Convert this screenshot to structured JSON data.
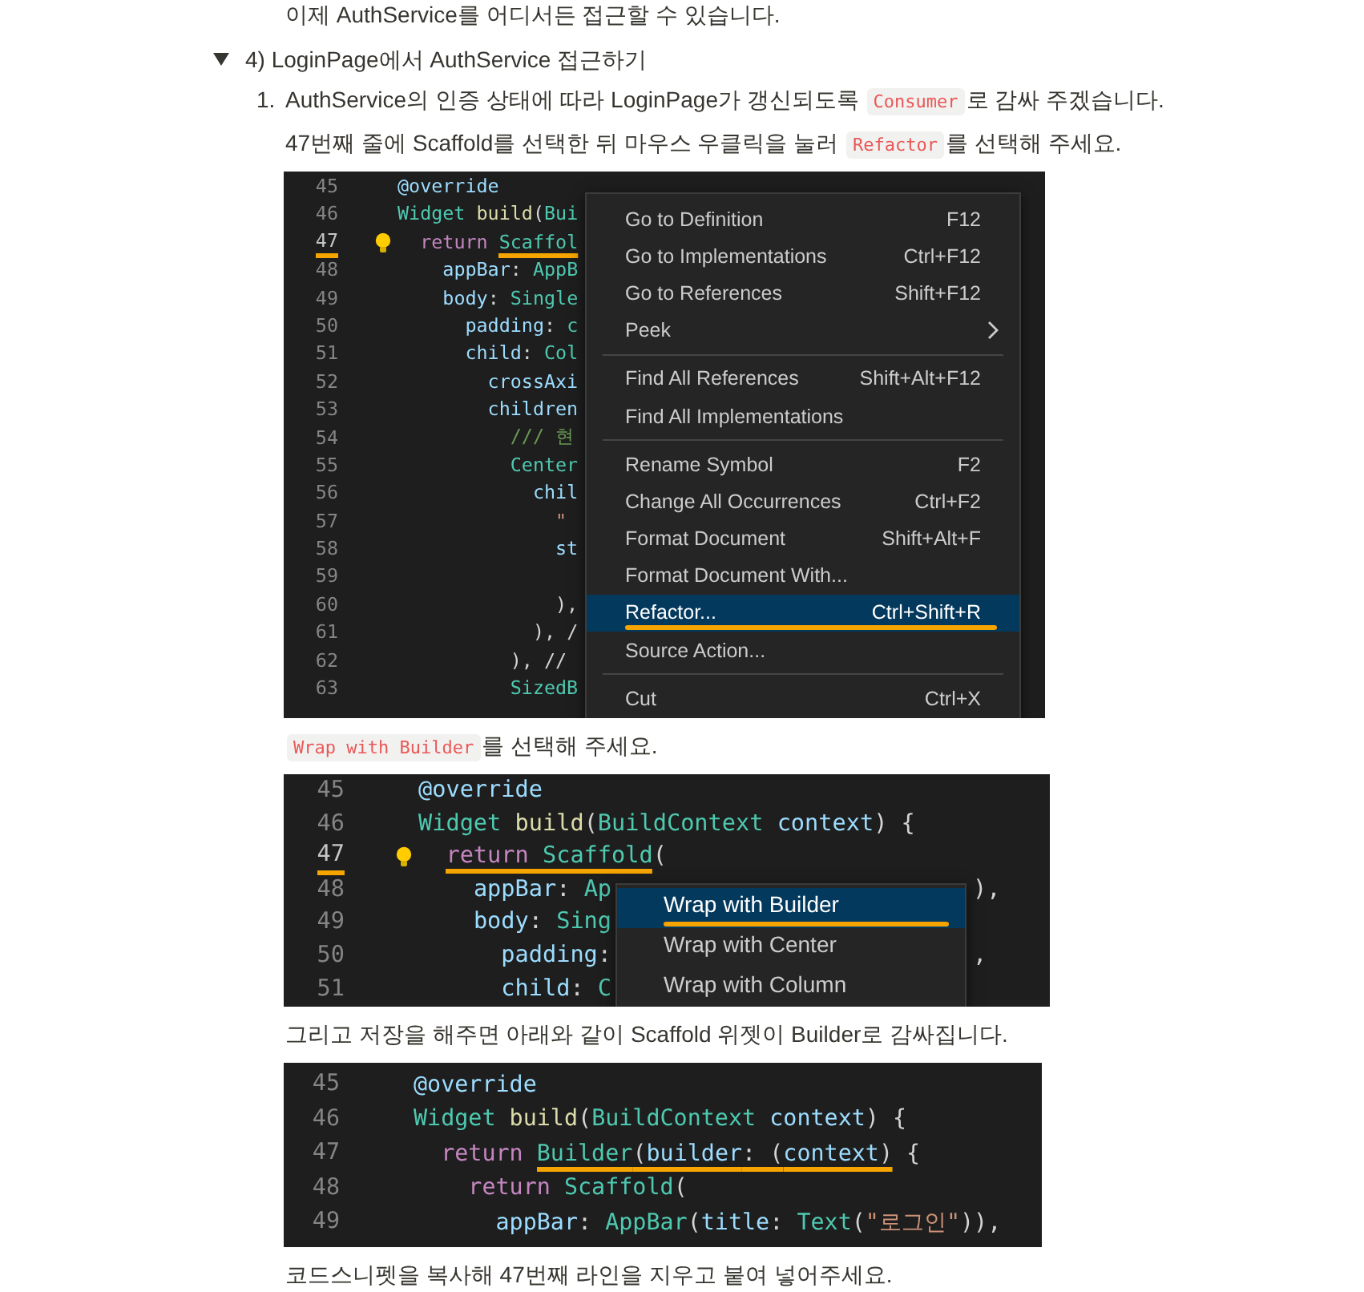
{
  "content": [
    {
      "kind": "paragraph",
      "parts": [
        {
          "kind": "text",
          "text": "이제 AuthService를 어디서든 접근할 수 있습니다."
        }
      ]
    },
    {
      "kind": "toggle",
      "title": "4) LoginPage에서 AuthService 접근하기",
      "expanded": true,
      "children": [
        {
          "kind": "list_item",
          "number": "1.",
          "children": [
            {
              "kind": "paragraph",
              "parts": [
                {
                  "kind": "text",
                  "text": "AuthService의 인증 상태에 따라 LoginPage가 갱신되도록 "
                },
                {
                  "kind": "code",
                  "text": "Consumer"
                },
                {
                  "kind": "text",
                  "text": "로 감싸 주겠습니다."
                }
              ]
            },
            {
              "kind": "paragraph",
              "parts": [
                {
                  "kind": "text",
                  "text": "47번째 줄에 Scaffold를 선택한 뒤 마우스 우클릭을 눌러 "
                },
                {
                  "kind": "code",
                  "text": "Refactor"
                },
                {
                  "kind": "text",
                  "text": "를 선택해 주세요."
                }
              ]
            },
            {
              "kind": "screenshot",
              "lines": [
                {
                  "number": "45",
                  "current": false,
                  "marked": false,
                  "bulb": false,
                  "tokens": [
                    {
                      "text": "@override",
                      "kind": "var",
                      "marked": false
                    }
                  ]
                },
                {
                  "number": "46",
                  "current": false,
                  "marked": false,
                  "bulb": false,
                  "tokens": [
                    {
                      "text": "Widget ",
                      "kind": "type",
                      "marked": false
                    },
                    {
                      "text": "build",
                      "kind": "func",
                      "marked": false
                    },
                    {
                      "text": "(",
                      "kind": "plain",
                      "marked": false
                    },
                    {
                      "text": "Bui",
                      "kind": "type",
                      "marked": false
                    }
                  ]
                },
                {
                  "number": "47",
                  "current": true,
                  "marked": true,
                  "bulb": true,
                  "tokens": [
                    {
                      "text": "  return ",
                      "kind": "keyword",
                      "marked": false
                    },
                    {
                      "text": "Scaffol",
                      "kind": "type",
                      "marked": true
                    }
                  ]
                },
                {
                  "number": "48",
                  "current": false,
                  "marked": false,
                  "bulb": false,
                  "tokens": [
                    {
                      "text": "    appBar",
                      "kind": "var",
                      "marked": false
                    },
                    {
                      "text": ": ",
                      "kind": "plain",
                      "marked": false
                    },
                    {
                      "text": "AppB",
                      "kind": "type",
                      "marked": false
                    }
                  ]
                },
                {
                  "number": "49",
                  "current": false,
                  "marked": false,
                  "bulb": false,
                  "tokens": [
                    {
                      "text": "    body",
                      "kind": "var",
                      "marked": false
                    },
                    {
                      "text": ": ",
                      "kind": "plain",
                      "marked": false
                    },
                    {
                      "text": "Single",
                      "kind": "type",
                      "marked": false
                    }
                  ]
                },
                {
                  "number": "50",
                  "current": false,
                  "marked": false,
                  "bulb": false,
                  "tokens": [
                    {
                      "text": "      padding",
                      "kind": "var",
                      "marked": false
                    },
                    {
                      "text": ": ",
                      "kind": "plain",
                      "marked": false
                    },
                    {
                      "text": "c",
                      "kind": "type",
                      "marked": false
                    }
                  ]
                },
                {
                  "number": "51",
                  "current": false,
                  "marked": false,
                  "bulb": false,
                  "tokens": [
                    {
                      "text": "      child",
                      "kind": "var",
                      "marked": false
                    },
                    {
                      "text": ": ",
                      "kind": "plain",
                      "marked": false
                    },
                    {
                      "text": "Col",
                      "kind": "type",
                      "marked": false
                    }
                  ]
                },
                {
                  "number": "52",
                  "current": false,
                  "marked": false,
                  "bulb": false,
                  "tokens": [
                    {
                      "text": "        crossAxi",
                      "kind": "var",
                      "marked": false
                    }
                  ]
                },
                {
                  "number": "53",
                  "current": false,
                  "marked": false,
                  "bulb": false,
                  "tokens": [
                    {
                      "text": "        children",
                      "kind": "var",
                      "marked": false
                    }
                  ]
                },
                {
                  "number": "54",
                  "current": false,
                  "marked": false,
                  "bulb": false,
                  "tokens": [
                    {
                      "text": "          /// 현",
                      "kind": "comment",
                      "marked": false
                    }
                  ]
                },
                {
                  "number": "55",
                  "current": false,
                  "marked": false,
                  "bulb": false,
                  "tokens": [
                    {
                      "text": "          Center",
                      "kind": "type",
                      "marked": false
                    }
                  ]
                },
                {
                  "number": "56",
                  "current": false,
                  "marked": false,
                  "bulb": false,
                  "tokens": [
                    {
                      "text": "            chil",
                      "kind": "var",
                      "marked": false
                    }
                  ]
                },
                {
                  "number": "57",
                  "current": false,
                  "marked": false,
                  "bulb": false,
                  "tokens": [
                    {
                      "text": "              \"",
                      "kind": "string",
                      "marked": false
                    }
                  ]
                },
                {
                  "number": "58",
                  "current": false,
                  "marked": false,
                  "bulb": false,
                  "tokens": [
                    {
                      "text": "              st",
                      "kind": "var",
                      "marked": false
                    }
                  ]
                },
                {
                  "number": "59",
                  "current": false,
                  "marked": false,
                  "bulb": false
                },
                {
                  "number": "60",
                  "current": false,
                  "marked": false,
                  "bulb": false,
                  "tokens": [
                    {
                      "text": "              ),",
                      "kind": "plain",
                      "marked": false
                    }
                  ]
                },
                {
                  "number": "61",
                  "current": false,
                  "marked": false,
                  "bulb": false,
                  "tokens": [
                    {
                      "text": "            ), /",
                      "kind": "plain",
                      "marked": false
                    }
                  ]
                },
                {
                  "number": "62",
                  "current": false,
                  "marked": false,
                  "bulb": false,
                  "tokens": [
                    {
                      "text": "          ), //",
                      "kind": "plain",
                      "marked": false
                    }
                  ]
                },
                {
                  "number": "63",
                  "current": false,
                  "marked": false,
                  "bulb": false,
                  "tokens": [
                    {
                      "text": "          SizedB",
                      "kind": "type",
                      "marked": false
                    }
                  ]
                }
              ],
              "menu": {
                "groups": [
                  [
                    {
                      "label": "Go to Definition",
                      "shortcut": "F12",
                      "selected": false,
                      "underlined": false,
                      "submenu": false
                    },
                    {
                      "label": "Go to Implementations",
                      "shortcut": "Ctrl+F12",
                      "selected": false,
                      "underlined": false,
                      "submenu": false
                    },
                    {
                      "label": "Go to References",
                      "shortcut": "Shift+F12",
                      "selected": false,
                      "underlined": false,
                      "submenu": false
                    },
                    {
                      "label": "Peek",
                      "selected": false,
                      "underlined": false,
                      "submenu": true
                    }
                  ],
                  [
                    {
                      "label": "Find All References",
                      "shortcut": "Shift+Alt+F12",
                      "selected": false,
                      "underlined": false,
                      "submenu": false
                    },
                    {
                      "label": "Find All Implementations",
                      "selected": false,
                      "underlined": false,
                      "submenu": false
                    }
                  ],
                  [
                    {
                      "label": "Rename Symbol",
                      "shortcut": "F2",
                      "selected": false,
                      "underlined": false,
                      "submenu": false
                    },
                    {
                      "label": "Change All Occurrences",
                      "shortcut": "Ctrl+F2",
                      "selected": false,
                      "underlined": false,
                      "submenu": false
                    },
                    {
                      "label": "Format Document",
                      "shortcut": "Shift+Alt+F",
                      "selected": false,
                      "underlined": false,
                      "submenu": false
                    },
                    {
                      "label": "Format Document With...",
                      "selected": false,
                      "underlined": false,
                      "submenu": false
                    },
                    {
                      "label": "Refactor...",
                      "shortcut": "Ctrl+Shift+R",
                      "selected": true,
                      "underlined": true,
                      "submenu": false
                    },
                    {
                      "label": "Source Action...",
                      "selected": false,
                      "underlined": false,
                      "submenu": false
                    }
                  ],
                  [
                    {
                      "label": "Cut",
                      "shortcut": "Ctrl+X",
                      "selected": false,
                      "underlined": false,
                      "submenu": false
                    }
                  ]
                ]
              }
            },
            {
              "kind": "paragraph",
              "parts": [
                {
                  "kind": "code",
                  "text": "Wrap with Builder"
                },
                {
                  "kind": "text",
                  "text": "를 선택해 주세요."
                }
              ]
            },
            {
              "kind": "screenshot",
              "lines": [
                {
                  "number": "45",
                  "current": false,
                  "marked": false,
                  "bulb": false,
                  "tokens": [
                    {
                      "text": "@override",
                      "kind": "var",
                      "marked": false
                    }
                  ]
                },
                {
                  "number": "46",
                  "current": false,
                  "marked": false,
                  "bulb": false,
                  "tokens": [
                    {
                      "text": "Widget ",
                      "kind": "type",
                      "marked": false
                    },
                    {
                      "text": "build",
                      "kind": "func",
                      "marked": false
                    },
                    {
                      "text": "(",
                      "kind": "plain",
                      "marked": false
                    },
                    {
                      "text": "BuildContext ",
                      "kind": "type",
                      "marked": false
                    },
                    {
                      "text": "context",
                      "kind": "var",
                      "marked": false
                    },
                    {
                      "text": ") {",
                      "kind": "plain",
                      "marked": false
                    }
                  ]
                },
                {
                  "number": "47",
                  "current": true,
                  "marked": true,
                  "bulb": true,
                  "tokens": [
                    {
                      "text": "  return ",
                      "kind": "keyword",
                      "marked": true
                    },
                    {
                      "text": "Scaffold",
                      "kind": "type",
                      "marked": true
                    },
                    {
                      "text": "(",
                      "kind": "plain",
                      "marked": false
                    }
                  ]
                },
                {
                  "number": "48",
                  "current": false,
                  "marked": false,
                  "bulb": false,
                  "tokens": [
                    {
                      "text": "    appBar",
                      "kind": "var",
                      "marked": false
                    },
                    {
                      "text": ": ",
                      "kind": "plain",
                      "marked": false
                    },
                    {
                      "text": "Ap",
                      "kind": "type",
                      "marked": false
                    }
                  ],
                  "tail": "),"
                },
                {
                  "number": "49",
                  "current": false,
                  "marked": false,
                  "bulb": false,
                  "tokens": [
                    {
                      "text": "    body",
                      "kind": "var",
                      "marked": false
                    },
                    {
                      "text": ": ",
                      "kind": "plain",
                      "marked": false
                    },
                    {
                      "text": "Sing",
                      "kind": "type",
                      "marked": false
                    }
                  ]
                },
                {
                  "number": "50",
                  "current": false,
                  "marked": false,
                  "bulb": false,
                  "tokens": [
                    {
                      "text": "      padding",
                      "kind": "var",
                      "marked": false
                    },
                    {
                      "text": ":",
                      "kind": "plain",
                      "marked": false
                    }
                  ],
                  "tail": ","
                },
                {
                  "number": "51",
                  "current": false,
                  "marked": false,
                  "bulb": false,
                  "tokens": [
                    {
                      "text": "      child",
                      "kind": "var",
                      "marked": false
                    },
                    {
                      "text": ": ",
                      "kind": "plain",
                      "marked": false
                    },
                    {
                      "text": "C",
                      "kind": "type",
                      "marked": false
                    }
                  ]
                }
              ],
              "menu": {
                "groups": [
                  [
                    {
                      "label": "Wrap with Builder",
                      "selected": true,
                      "underlined": true,
                      "submenu": false
                    },
                    {
                      "label": "Wrap with Center",
                      "selected": false,
                      "underlined": false,
                      "submenu": false
                    },
                    {
                      "label": "Wrap with Column",
                      "selected": false,
                      "underlined": false,
                      "submenu": false
                    }
                  ]
                ]
              }
            },
            {
              "kind": "paragraph",
              "parts": [
                {
                  "kind": "text",
                  "text": "그리고 저장을 해주면 아래와 같이 Scaffold 위젯이 Builder로 감싸집니다."
                }
              ]
            },
            {
              "kind": "screenshot",
              "lines": [
                {
                  "number": "45",
                  "current": false,
                  "marked": false,
                  "bulb": false,
                  "tokens": [
                    {
                      "text": "@override",
                      "kind": "var",
                      "marked": false
                    }
                  ]
                },
                {
                  "number": "46",
                  "current": false,
                  "marked": false,
                  "bulb": false,
                  "tokens": [
                    {
                      "text": "Widget ",
                      "kind": "type",
                      "marked": false
                    },
                    {
                      "text": "build",
                      "kind": "func",
                      "marked": false
                    },
                    {
                      "text": "(",
                      "kind": "plain",
                      "marked": false
                    },
                    {
                      "text": "BuildContext ",
                      "kind": "type",
                      "marked": false
                    },
                    {
                      "text": "context",
                      "kind": "var",
                      "marked": false
                    },
                    {
                      "text": ") {",
                      "kind": "plain",
                      "marked": false
                    }
                  ]
                },
                {
                  "number": "47",
                  "current": false,
                  "marked": false,
                  "bulb": false,
                  "tokens": [
                    {
                      "text": "  return ",
                      "kind": "keyword",
                      "marked": false
                    },
                    {
                      "text": "Builder",
                      "kind": "type",
                      "marked": true
                    },
                    {
                      "text": "(",
                      "kind": "plain",
                      "marked": true
                    },
                    {
                      "text": "builder",
                      "kind": "var",
                      "marked": true
                    },
                    {
                      "text": ": (",
                      "kind": "plain",
                      "marked": true
                    },
                    {
                      "text": "context",
                      "kind": "var",
                      "marked": true
                    },
                    {
                      "text": ")",
                      "kind": "plain",
                      "marked": true
                    },
                    {
                      "text": " {",
                      "kind": "plain",
                      "marked": false
                    }
                  ]
                },
                {
                  "number": "48",
                  "current": false,
                  "marked": false,
                  "bulb": false,
                  "tokens": [
                    {
                      "text": "    return ",
                      "kind": "keyword",
                      "marked": false
                    },
                    {
                      "text": "Scaffold",
                      "kind": "type",
                      "marked": false
                    },
                    {
                      "text": "(",
                      "kind": "plain",
                      "marked": false
                    }
                  ]
                },
                {
                  "number": "49",
                  "current": false,
                  "marked": false,
                  "bulb": false,
                  "tokens": [
                    {
                      "text": "      appBar",
                      "kind": "var",
                      "marked": false
                    },
                    {
                      "text": ": ",
                      "kind": "plain",
                      "marked": false
                    },
                    {
                      "text": "AppBar",
                      "kind": "type",
                      "marked": false
                    },
                    {
                      "text": "(",
                      "kind": "plain",
                      "marked": false
                    },
                    {
                      "text": "title",
                      "kind": "var",
                      "marked": false
                    },
                    {
                      "text": ": ",
                      "kind": "plain",
                      "marked": false
                    },
                    {
                      "text": "Text",
                      "kind": "type",
                      "marked": false
                    },
                    {
                      "text": "(",
                      "kind": "plain",
                      "marked": false
                    },
                    {
                      "text": "\"로그인\"",
                      "kind": "string",
                      "marked": false
                    },
                    {
                      "text": ")),",
                      "kind": "plain",
                      "marked": false
                    }
                  ]
                }
              ]
            },
            {
              "kind": "paragraph",
              "parts": [
                {
                  "kind": "text",
                  "text": "코드스니펫을 복사해 47번째 라인을 지우고 붙여 넣어주세요."
                }
              ]
            }
          ]
        }
      ]
    }
  ]
}
